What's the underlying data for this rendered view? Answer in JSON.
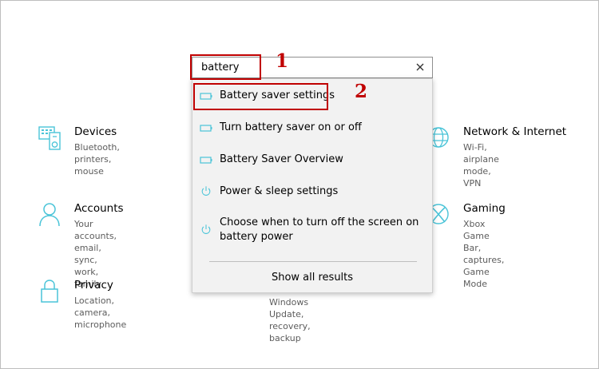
{
  "tiles": {
    "devices": {
      "title": "Devices",
      "desc": "Bluetooth, printers, mouse",
      "icon": "devices-icon"
    },
    "accounts": {
      "title": "Accounts",
      "desc_lines": [
        "Your accounts, email, sync,",
        "work, family"
      ],
      "icon": "person-icon"
    },
    "privacy": {
      "title": "Privacy",
      "desc": "Location, camera, microphone",
      "icon": "lock-icon"
    },
    "network": {
      "title": "Network & Internet",
      "desc": "Wi-Fi, airplane mode, VPN",
      "icon": "globe-icon"
    },
    "gaming": {
      "title": "Gaming",
      "desc_lines": [
        "Xbox Game Bar, captures, Game",
        "Mode"
      ],
      "icon": "xbox-icon"
    },
    "update": {
      "desc_lines": [
        "Windows Update, recovery,",
        "backup"
      ],
      "icon": "update-icon"
    }
  },
  "search": {
    "value": "battery",
    "clear_icon": "close-icon"
  },
  "results": [
    {
      "label": "Battery saver settings",
      "icon": "battery-icon"
    },
    {
      "label": "Turn battery saver on or off",
      "icon": "battery-icon"
    },
    {
      "label": "Battery Saver Overview",
      "icon": "battery-icon"
    },
    {
      "label": "Power & sleep settings",
      "icon": "power-icon"
    },
    {
      "label_lines": [
        "Choose when to turn off the screen on",
        "battery power"
      ],
      "icon": "power-icon"
    }
  ],
  "show_all": "Show all results",
  "annotations": {
    "one": "1",
    "two": "2"
  },
  "colors": {
    "accent": "#4ac4d8",
    "highlight": "#c00000"
  }
}
